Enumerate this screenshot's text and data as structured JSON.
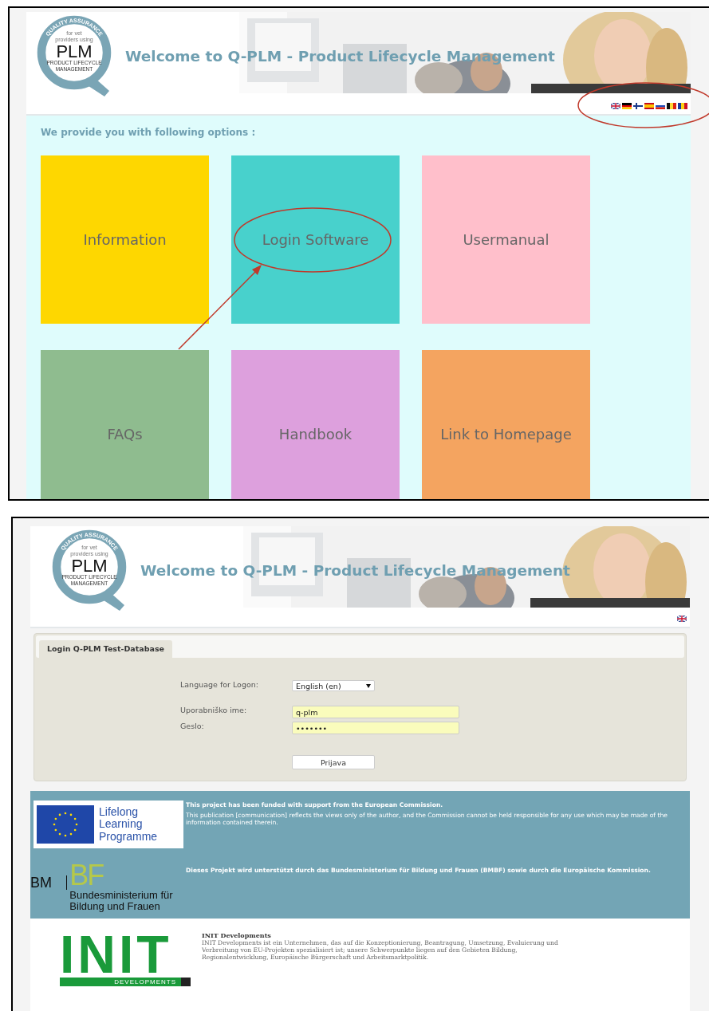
{
  "home": {
    "header": {
      "logo": {
        "arc_text": "QUALITY ASSURANCE",
        "small_text_1": "for vet",
        "small_text_2": "providers using",
        "mark": "PLM",
        "bottom_text_1": "PRODUCT LIFECYCLE",
        "bottom_text_2": "MANAGEMENT"
      },
      "title": "Welcome to Q-PLM - Product Lifecycle Management"
    },
    "intro": "We provide you with following options :",
    "tiles": [
      {
        "label": "Information",
        "color": "#fed700"
      },
      {
        "label": "Login Software",
        "color": "#48d1cc"
      },
      {
        "label": "Usermanual",
        "color": "#ffbfcb"
      },
      {
        "label": "FAQs",
        "color": "#8fbc8f"
      },
      {
        "label": "Handbook",
        "color": "#dda0dd"
      },
      {
        "label": "Link to Homepage",
        "color": "#f4a460"
      }
    ]
  },
  "login": {
    "header": {
      "logo": {
        "arc_text": "QUALITY ASSURANCE",
        "small_text_1": "for vet",
        "small_text_2": "providers using",
        "mark": "PLM",
        "bottom_text_1": "PRODUCT LIFECYCLE",
        "bottom_text_2": "MANAGEMENT"
      },
      "title": "Welcome to Q-PLM - Product Lifecycle Management"
    },
    "tab": {
      "label": "Login Q-PLM Test-Database",
      "selected": true
    },
    "fields": [
      {
        "kind": "select",
        "label": "Language for Logon:",
        "value": "English (en)"
      },
      {
        "kind": "text",
        "label": "Uporabniško ime:",
        "value": "q-plm"
      },
      {
        "kind": "password",
        "label": "Geslo:",
        "value": "•••••••"
      }
    ],
    "button": "Prijava",
    "footer": {
      "eu_logo": [
        "Lifelong",
        "Learning",
        "Programme"
      ],
      "eu_title": "This project has been funded with support from the European Commission.",
      "eu_text": "This publication [communication] reflects the views only of the author, and the Commission cannot be held responsible for any use which may be made of the information contained therein.",
      "bm_logo": {
        "left": "BM",
        "top": "BF",
        "line_1": "Bundesministerium für",
        "line_2": "Bildung und Frauen"
      },
      "bm_text": "Dieses Projekt wird unterstützt durch das Bundesministerium für Bildung und Frauen (BMBF) sowie durch die Europäische Kommission.",
      "init_logo": {
        "mark": "INIT",
        "sub": "DEVELOPMENTS"
      },
      "init_title": "INIT Developments",
      "init_text": "INIT Developments ist ein Unternehmen, das auf die Konzeptionierung, Beantragung, Umsetzung, Evaluierung und Verbreitung von EU-Projekten spezialisiert ist; unsere Schwerpunkte liegen auf den Gebieten Bildung, Regionalentwicklung, Europäische Bürgerschaft und Arbeitsmarktpolitik."
    }
  }
}
